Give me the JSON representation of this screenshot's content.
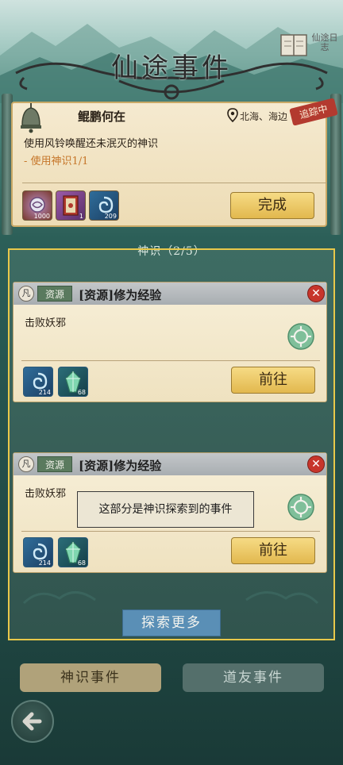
{
  "header": {
    "title": "仙途事件",
    "journal_label": "仙途日志"
  },
  "quest": {
    "name": "鲲鹏何在",
    "location": "北海、海边",
    "tracking_badge": "追踪中",
    "description": "使用风铃唤醒还未泯灭的神识",
    "progress": "- 使用神识1/1",
    "rewards": [
      {
        "icon": "swirl-orb-icon",
        "count": "1000"
      },
      {
        "icon": "scroll-book-icon",
        "count": "1"
      },
      {
        "icon": "blue-vortex-icon",
        "count": "209"
      }
    ],
    "complete_label": "完成"
  },
  "sense": {
    "label": "神识（2/5）"
  },
  "events": [
    {
      "grade": "凡",
      "type_tag": "资源",
      "title": "[资源]修为经验",
      "description": "击败妖邪",
      "rewards": [
        {
          "icon": "blue-vortex-icon",
          "count": "214"
        },
        {
          "icon": "green-crystal-icon",
          "count": "68"
        }
      ],
      "go_label": "前往"
    },
    {
      "grade": "凡",
      "type_tag": "资源",
      "title": "[资源]修为经验",
      "description": "击败妖邪",
      "rewards": [
        {
          "icon": "blue-vortex-icon",
          "count": "214"
        },
        {
          "icon": "green-crystal-icon",
          "count": "68"
        }
      ],
      "go_label": "前往"
    }
  ],
  "tooltip": "这部分是神识探索到的事件",
  "explore_more_label": "探索更多",
  "tabs": [
    {
      "label": "神识事件",
      "active": true
    },
    {
      "label": "道友事件",
      "active": false
    }
  ],
  "colors": {
    "accent_gold": "#e2b84e",
    "highlight": "#e8c84a",
    "tracking_red": "#b33a2f",
    "close_red": "#c7352b"
  }
}
